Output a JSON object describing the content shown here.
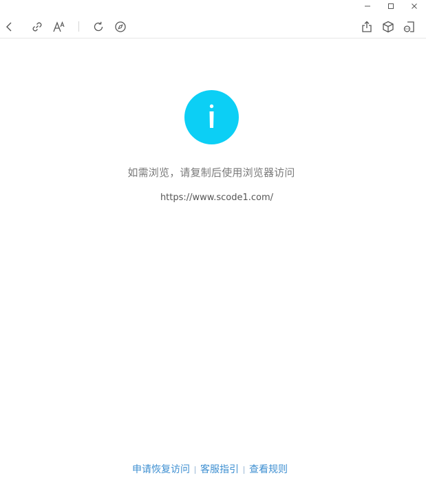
{
  "window_controls": {
    "minimize_icon": "minimize-icon",
    "maximize_icon": "maximize-icon",
    "close_icon": "close-icon"
  },
  "toolbar": {
    "left_icons": [
      "back-icon",
      "link-icon",
      "font-size-icon",
      "refresh-icon",
      "compass-icon"
    ],
    "right_icons": [
      "share-icon",
      "cube-icon",
      "mini-program-icon"
    ]
  },
  "main": {
    "status_icon": "info-icon",
    "status_icon_color": "#0ccff5",
    "message": "如需浏览，请复制后使用浏览器访问",
    "url": "https://www.scode1.com/"
  },
  "footer": {
    "links": [
      {
        "label": "申请恢复访问"
      },
      {
        "label": "客服指引"
      },
      {
        "label": "查看规则"
      }
    ],
    "link_color": "#3e8fd1"
  }
}
